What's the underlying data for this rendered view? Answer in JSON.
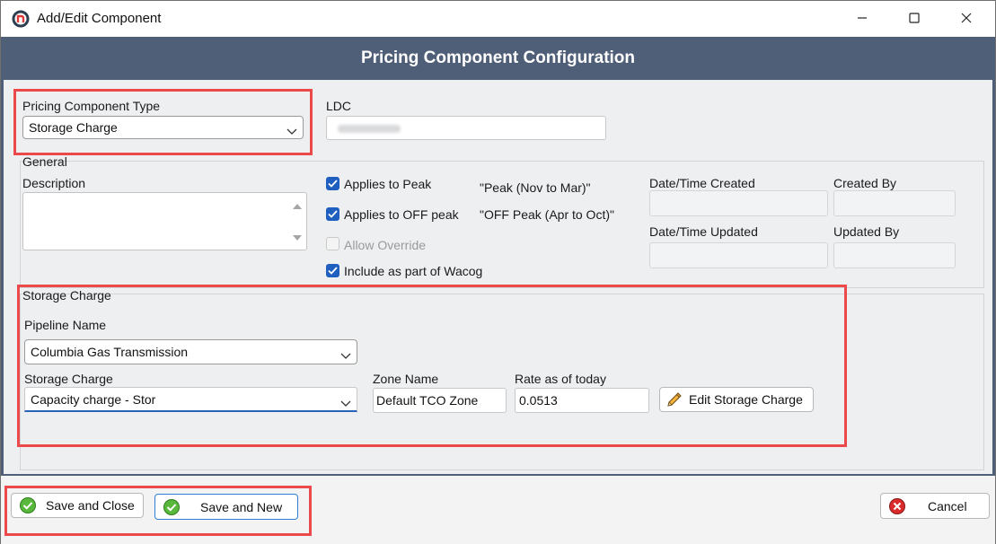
{
  "window": {
    "title": "Add/Edit Component",
    "icon": "app-logo-icon"
  },
  "header": {
    "title": "Pricing Component Configuration"
  },
  "pricing_type": {
    "label": "Pricing Component Type",
    "value": "Storage Charge"
  },
  "ldc": {
    "label": "LDC",
    "value": ""
  },
  "general": {
    "title": "General",
    "description_label": "Description",
    "description_value": "",
    "applies_peak": {
      "label": "Applies to Peak",
      "checked": true,
      "note": "\"Peak (Nov to Mar)\""
    },
    "applies_off_peak": {
      "label": "Applies to OFF peak",
      "checked": true,
      "note": "\"OFF Peak (Apr to Oct)\""
    },
    "allow_override": {
      "label": "Allow Override",
      "checked": false,
      "disabled": true
    },
    "include_wacog": {
      "label": "Include as part of Wacog",
      "checked": true
    },
    "date_created_label": "Date/Time Created",
    "created_by_label": "Created By",
    "date_updated_label": "Date/Time Updated",
    "updated_by_label": "Updated By"
  },
  "storage": {
    "title": "Storage Charge",
    "pipeline_label": "Pipeline Name",
    "pipeline_value": "Columbia Gas Transmission",
    "charge_label": "Storage Charge",
    "charge_value": "Capacity charge - Stor",
    "zone_label": "Zone Name",
    "zone_value": "Default TCO Zone",
    "rate_label": "Rate as of today",
    "rate_value": "0.0513",
    "edit_button": "Edit Storage Charge"
  },
  "footer": {
    "save_close": "Save and Close",
    "save_new": "Save and New",
    "cancel": "Cancel"
  },
  "colors": {
    "header_bg": "#505f78",
    "highlight": "#ec4a4a",
    "checkbox": "#1f5fbf",
    "ok_icon": "#58b83b",
    "cancel_icon": "#d92b2b"
  }
}
